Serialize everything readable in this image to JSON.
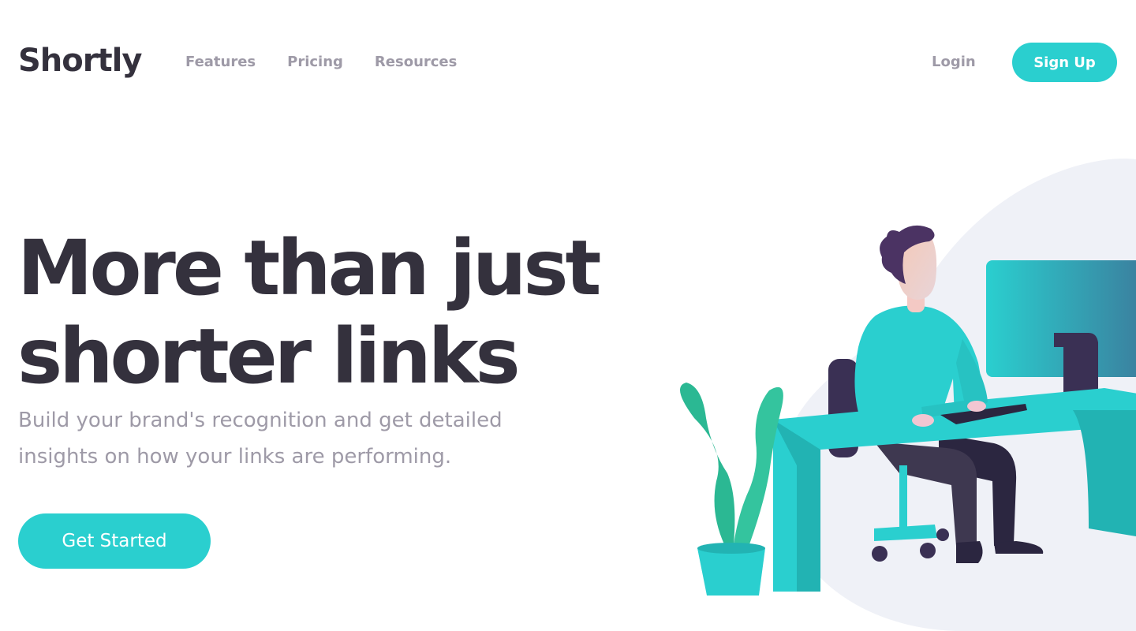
{
  "brand": {
    "name": "Shortly",
    "accent": "#2acfcf",
    "text_dark": "#34313d",
    "text_muted": "#9e9aa7"
  },
  "nav": {
    "items": [
      {
        "label": "Features"
      },
      {
        "label": "Pricing"
      },
      {
        "label": "Resources"
      }
    ],
    "login_label": "Login",
    "signup_label": "Sign Up"
  },
  "hero": {
    "title_line1": "More than just",
    "title_line2": "shorter links",
    "subtitle_line1": "Build your brand's recognition and get detailed",
    "subtitle_line2": "insights on how your links are performing.",
    "cta_label": "Get Started"
  },
  "illustration": {
    "name": "person-working-illustration"
  }
}
